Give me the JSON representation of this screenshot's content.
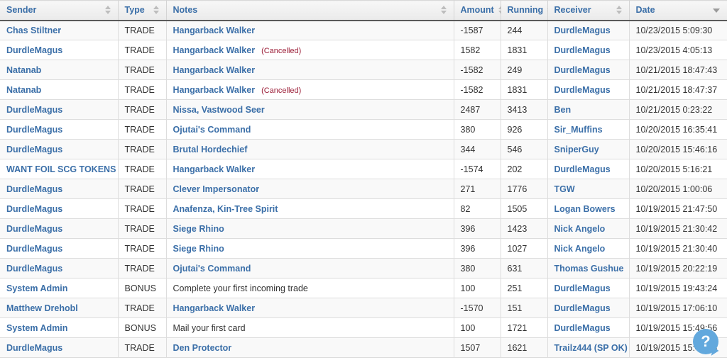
{
  "table": {
    "columns": [
      {
        "key": "sender",
        "label": "Sender",
        "sort": "both"
      },
      {
        "key": "type",
        "label": "Type",
        "sort": "both"
      },
      {
        "key": "notes",
        "label": "Notes",
        "sort": "both"
      },
      {
        "key": "amount",
        "label": "Amount",
        "sort": "both"
      },
      {
        "key": "running",
        "label": "Running",
        "sort": "both"
      },
      {
        "key": "receiver",
        "label": "Receiver",
        "sort": "both"
      },
      {
        "key": "date",
        "label": "Date",
        "sort": "desc"
      }
    ],
    "sorted_by": "Date",
    "sort_direction": "descending",
    "rows": [
      {
        "sender": "Chas Stiltner",
        "sender_link": true,
        "type": "TRADE",
        "notes": "Hangarback Walker",
        "notes_link": true,
        "cancelled": "",
        "amount": "-1587",
        "running": "244",
        "receiver": "DurdleMagus",
        "date": "10/23/2015 5:09:30"
      },
      {
        "sender": "DurdleMagus",
        "sender_link": true,
        "type": "TRADE",
        "notes": "Hangarback Walker",
        "notes_link": true,
        "cancelled": "(Cancelled)",
        "amount": "1582",
        "running": "1831",
        "receiver": "DurdleMagus",
        "date": "10/23/2015 4:05:13"
      },
      {
        "sender": "Natanab",
        "sender_link": true,
        "type": "TRADE",
        "notes": "Hangarback Walker",
        "notes_link": true,
        "cancelled": "",
        "amount": "-1582",
        "running": "249",
        "receiver": "DurdleMagus",
        "date": "10/21/2015 18:47:43"
      },
      {
        "sender": "Natanab",
        "sender_link": true,
        "type": "TRADE",
        "notes": "Hangarback Walker",
        "notes_link": true,
        "cancelled": "(Cancelled)",
        "amount": "-1582",
        "running": "1831",
        "receiver": "DurdleMagus",
        "date": "10/21/2015 18:47:37"
      },
      {
        "sender": "DurdleMagus",
        "sender_link": true,
        "type": "TRADE",
        "notes": "Nissa, Vastwood Seer",
        "notes_link": true,
        "cancelled": "",
        "amount": "2487",
        "running": "3413",
        "receiver": "Ben",
        "date": "10/21/2015 0:23:22"
      },
      {
        "sender": "DurdleMagus",
        "sender_link": true,
        "type": "TRADE",
        "notes": "Ojutai's Command",
        "notes_link": true,
        "cancelled": "",
        "amount": "380",
        "running": "926",
        "receiver": "Sir_Muffins",
        "date": "10/20/2015 16:35:41"
      },
      {
        "sender": "DurdleMagus",
        "sender_link": true,
        "type": "TRADE",
        "notes": "Brutal Hordechief",
        "notes_link": true,
        "cancelled": "",
        "amount": "344",
        "running": "546",
        "receiver": "SniperGuy",
        "date": "10/20/2015 15:46:16"
      },
      {
        "sender": "WANT FOIL SCG TOKENS",
        "sender_link": true,
        "type": "TRADE",
        "notes": "Hangarback Walker",
        "notes_link": true,
        "cancelled": "",
        "amount": "-1574",
        "running": "202",
        "receiver": "DurdleMagus",
        "date": "10/20/2015 5:16:21"
      },
      {
        "sender": "DurdleMagus",
        "sender_link": true,
        "type": "TRADE",
        "notes": "Clever Impersonator",
        "notes_link": true,
        "cancelled": "",
        "amount": "271",
        "running": "1776",
        "receiver": "TGW",
        "date": "10/20/2015 1:00:06"
      },
      {
        "sender": "DurdleMagus",
        "sender_link": true,
        "type": "TRADE",
        "notes": "Anafenza, Kin-Tree Spirit",
        "notes_link": true,
        "cancelled": "",
        "amount": "82",
        "running": "1505",
        "receiver": "Logan Bowers",
        "date": "10/19/2015 21:47:50"
      },
      {
        "sender": "DurdleMagus",
        "sender_link": true,
        "type": "TRADE",
        "notes": "Siege Rhino",
        "notes_link": true,
        "cancelled": "",
        "amount": "396",
        "running": "1423",
        "receiver": "Nick Angelo",
        "date": "10/19/2015 21:30:42"
      },
      {
        "sender": "DurdleMagus",
        "sender_link": true,
        "type": "TRADE",
        "notes": "Siege Rhino",
        "notes_link": true,
        "cancelled": "",
        "amount": "396",
        "running": "1027",
        "receiver": "Nick Angelo",
        "date": "10/19/2015 21:30:40"
      },
      {
        "sender": "DurdleMagus",
        "sender_link": true,
        "type": "TRADE",
        "notes": "Ojutai's Command",
        "notes_link": true,
        "cancelled": "",
        "amount": "380",
        "running": "631",
        "receiver": "Thomas Gushue",
        "date": "10/19/2015 20:22:19"
      },
      {
        "sender": "System Admin",
        "sender_link": true,
        "type": "BONUS",
        "notes": "Complete your first incoming trade",
        "notes_link": false,
        "cancelled": "",
        "amount": "100",
        "running": "251",
        "receiver": "DurdleMagus",
        "date": "10/19/2015 19:43:24"
      },
      {
        "sender": "Matthew Drehobl",
        "sender_link": true,
        "type": "TRADE",
        "notes": "Hangarback Walker",
        "notes_link": true,
        "cancelled": "",
        "amount": "-1570",
        "running": "151",
        "receiver": "DurdleMagus",
        "date": "10/19/2015 17:06:10"
      },
      {
        "sender": "System Admin",
        "sender_link": true,
        "type": "BONUS",
        "notes": "Mail your first card",
        "notes_link": false,
        "cancelled": "",
        "amount": "100",
        "running": "1721",
        "receiver": "DurdleMagus",
        "date": "10/19/2015 15:49:56"
      },
      {
        "sender": "DurdleMagus",
        "sender_link": true,
        "type": "TRADE",
        "notes": "Den Protector",
        "notes_link": true,
        "cancelled": "",
        "amount": "1507",
        "running": "1621",
        "receiver": "Trailz444 (SP OK)",
        "date": "10/19/2015 15:49:56"
      }
    ]
  },
  "help": {
    "glyph": "?",
    "icon": "help-question-bubble-icon"
  },
  "colors": {
    "link": "#3b6fa8",
    "cancelled": "#9c1f38",
    "header_bg": "#eaeaea",
    "help_bubble": "#62a8dd"
  }
}
